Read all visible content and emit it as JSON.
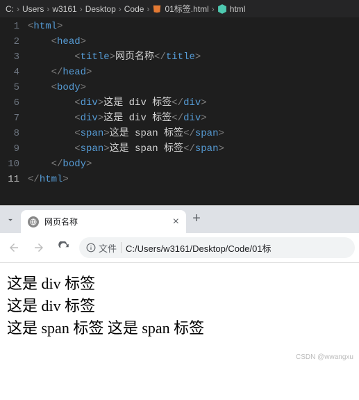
{
  "breadcrumb": {
    "parts": [
      "C:",
      "Users",
      "w3161",
      "Desktop",
      "Code",
      "01标签.html",
      "html"
    ],
    "sep": "›"
  },
  "editor": {
    "lines": [
      1,
      2,
      3,
      4,
      5,
      6,
      7,
      8,
      9,
      10,
      11
    ],
    "active_line": 11,
    "code": [
      {
        "indent": 0,
        "open": "html",
        "close": null,
        "text": null
      },
      {
        "indent": 1,
        "open": "head",
        "close": null,
        "text": null
      },
      {
        "indent": 2,
        "open": "title",
        "close": "title",
        "text": "网页名称"
      },
      {
        "indent": 1,
        "open": null,
        "close": "head",
        "text": null
      },
      {
        "indent": 1,
        "open": "body",
        "close": null,
        "text": null
      },
      {
        "indent": 2,
        "open": "div",
        "close": "div",
        "text": "这是 div 标签"
      },
      {
        "indent": 2,
        "open": "div",
        "close": "div",
        "text": "这是 div 标签"
      },
      {
        "indent": 2,
        "open": "span",
        "close": "span",
        "text": "这是 span 标签"
      },
      {
        "indent": 2,
        "open": "span",
        "close": "span",
        "text": "这是 span 标签"
      },
      {
        "indent": 1,
        "open": null,
        "close": "body",
        "text": null
      },
      {
        "indent": 0,
        "open": null,
        "close": "html",
        "text": null
      }
    ]
  },
  "browser": {
    "tab_title": "网页名称",
    "file_label": "文件",
    "url": "C:/Users/w3161/Desktop/Code/01标"
  },
  "page": {
    "div1": "这是 div 标签",
    "div2": "这是 div 标签",
    "span1": "这是 span 标签",
    "span2": "这是 span 标签"
  },
  "watermark": "CSDN @wwangxu"
}
